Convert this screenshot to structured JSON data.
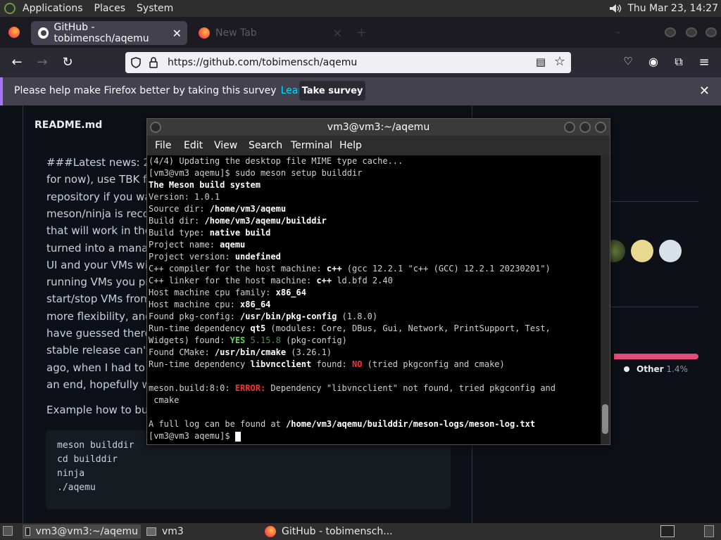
{
  "top_panel": {
    "menus": [
      "Applications",
      "Places",
      "System"
    ],
    "clock": "Thu Mar 23, 14:27"
  },
  "browser": {
    "tabs": [
      {
        "title": "GitHub - tobimensch/aqemu",
        "active": true
      },
      {
        "title": "New Tab",
        "active": false
      }
    ],
    "url": "https://github.com/tobimensch/aqemu",
    "notification": {
      "message": "Please help make Firefox better by taking this survey",
      "link": "Learn more",
      "button": "Take survey"
    }
  },
  "page": {
    "readme_title": "README.md",
    "readme_lines": [
      "###Latest news: 202",
      "for now), use TBK fo",
      "repository if you war",
      "meson/ninja is recor",
      "that will work in the r",
      "turned into a manag",
      "UI and your VMs wil",
      "running VMs you pre",
      "start/stop VMs from",
      "more flexibility, and h",
      "have guessed there",
      "stable release can't l",
      "ago, when I had to s",
      "an end, hopefully wit"
    ],
    "example_text": "Example how to buil",
    "code_lines": [
      "meson builddir",
      "cd builddir",
      "ninja",
      "./aqemu"
    ],
    "language_other": {
      "name": "Other",
      "percent": "1.4%"
    }
  },
  "terminal": {
    "title": "vm3@vm3:~/aqemu",
    "menus": [
      "File",
      "Edit",
      "View",
      "Search",
      "Terminal",
      "Help"
    ],
    "lines": [
      [
        {
          "t": "(4/4) Updating the desktop file MIME type cache..."
        }
      ],
      [
        {
          "t": "[vm3@vm3 aqemu]$ sudo meson setup builddir"
        }
      ],
      [
        {
          "t": "The Meson build system",
          "c": "b"
        }
      ],
      [
        {
          "t": "Version: 1.0.1"
        }
      ],
      [
        {
          "t": "Source dir: "
        },
        {
          "t": "/home/vm3/aqemu",
          "c": "b"
        }
      ],
      [
        {
          "t": "Build dir: "
        },
        {
          "t": "/home/vm3/aqemu/builddir",
          "c": "b"
        }
      ],
      [
        {
          "t": "Build type: "
        },
        {
          "t": "native build",
          "c": "b"
        }
      ],
      [
        {
          "t": "Project name: "
        },
        {
          "t": "aqemu",
          "c": "b"
        }
      ],
      [
        {
          "t": "Project version: "
        },
        {
          "t": "undefined",
          "c": "b"
        }
      ],
      [
        {
          "t": "C++ compiler for the host machine: "
        },
        {
          "t": "c++",
          "c": "b"
        },
        {
          "t": " (gcc 12.2.1 \"c++ (GCC) 12.2.1 20230201\")"
        }
      ],
      [
        {
          "t": "C++ linker for the host machine: "
        },
        {
          "t": "c++",
          "c": "b"
        },
        {
          "t": " ld.bfd 2.40"
        }
      ],
      [
        {
          "t": "Host machine cpu family: "
        },
        {
          "t": "x86_64",
          "c": "b"
        }
      ],
      [
        {
          "t": "Host machine cpu: "
        },
        {
          "t": "x86_64",
          "c": "b"
        }
      ],
      [
        {
          "t": "Found pkg-config: "
        },
        {
          "t": "/usr/bin/pkg-config",
          "c": "b"
        },
        {
          "t": " (1.8.0)"
        }
      ],
      [
        {
          "t": "Run-time dependency "
        },
        {
          "t": "qt5",
          "c": "b"
        },
        {
          "t": " (modules: Core, DBus, Gui, Network, PrintSupport, Test,"
        }
      ],
      [
        {
          "t": "Widgets) found: "
        },
        {
          "t": "YES",
          "c": "g"
        },
        {
          "t": " "
        },
        {
          "t": "5.15.8",
          "c": "gd"
        },
        {
          "t": " (pkg-config)"
        }
      ],
      [
        {
          "t": "Found CMake: "
        },
        {
          "t": "/usr/bin/cmake",
          "c": "b"
        },
        {
          "t": " (3.26.1)"
        }
      ],
      [
        {
          "t": "Run-time dependency "
        },
        {
          "t": "libvncclient",
          "c": "b"
        },
        {
          "t": " found: "
        },
        {
          "t": "NO",
          "c": "r"
        },
        {
          "t": " (tried pkgconfig and cmake)"
        }
      ],
      [
        {
          "t": ""
        }
      ],
      [
        {
          "t": "meson.build:8:0: "
        },
        {
          "t": "ERROR:",
          "c": "r"
        },
        {
          "t": " Dependency \"libvncclient\" not found, tried pkgconfig and"
        }
      ],
      [
        {
          "t": " cmake"
        }
      ],
      [
        {
          "t": ""
        }
      ],
      [
        {
          "t": "A full log can be found at "
        },
        {
          "t": "/home/vm3/aqemu/builddir/meson-logs/meson-log.txt",
          "c": "b"
        }
      ],
      [
        {
          "t": "[vm3@vm3 aqemu]$ "
        }
      ]
    ]
  },
  "taskbar": {
    "items": [
      {
        "label": "vm3@vm3:~/aqemu",
        "active": true
      },
      {
        "label": "vm3",
        "active": false
      },
      {
        "label": "GitHub - tobimensch...",
        "active": false
      }
    ]
  }
}
